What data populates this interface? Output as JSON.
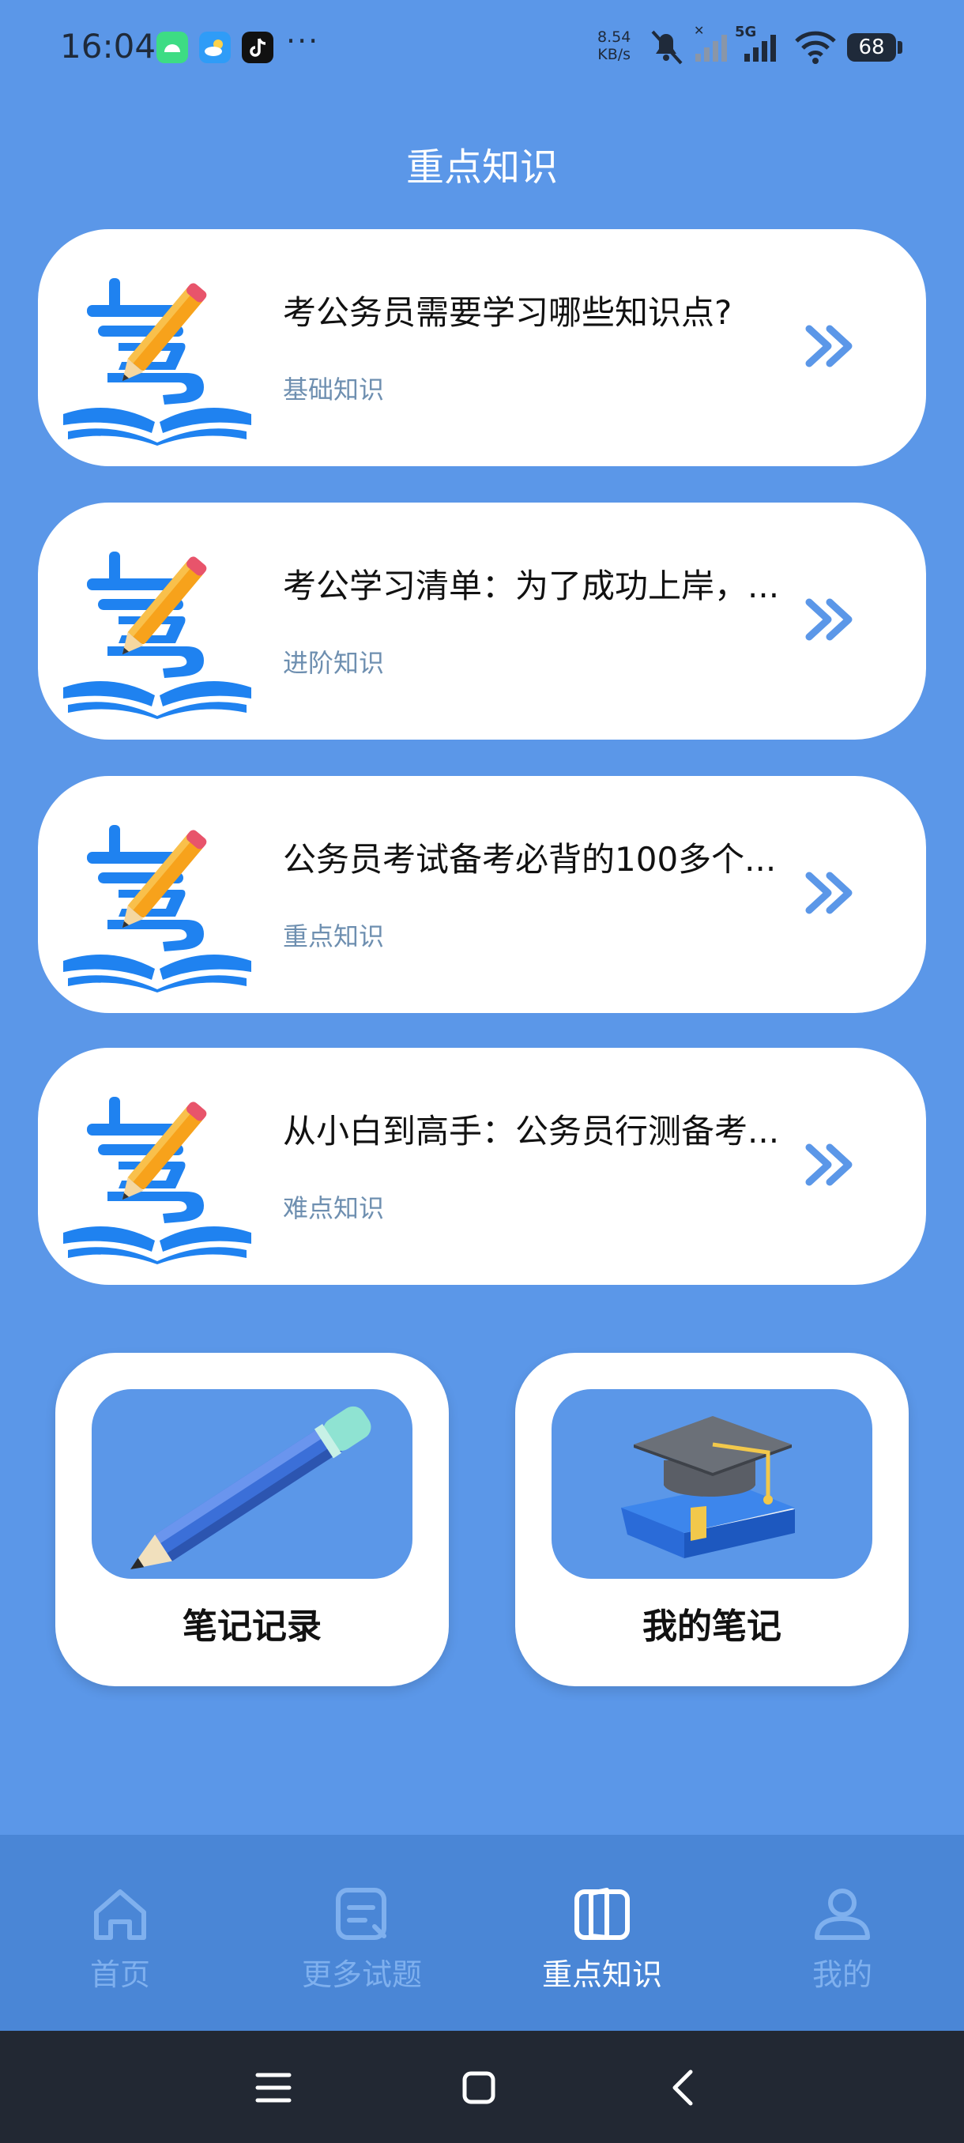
{
  "status_bar": {
    "time": "16:04",
    "net_speed_value": "8.54",
    "net_speed_unit": "KB/s",
    "network_type": "5G",
    "battery": "68",
    "more": "···",
    "icons": [
      "android-app-icon",
      "weather-app-icon",
      "tiktok-app-icon",
      "mute-icon",
      "signal-icon",
      "signal-5g-icon",
      "wifi-icon",
      "battery-icon"
    ]
  },
  "page": {
    "title": "重点知识"
  },
  "cards": [
    {
      "title": "考公务员需要学习哪些知识点?",
      "subtitle": "基础知识"
    },
    {
      "title": "考公学习清单：为了成功上岸，...",
      "subtitle": "进阶知识"
    },
    {
      "title": "公务员考试备考必背的100多个...",
      "subtitle": "重点知识"
    },
    {
      "title": "从小白到高手：公务员行测备考...",
      "subtitle": "难点知识"
    }
  ],
  "tiles": [
    {
      "label": "笔记记录",
      "icon": "pencil-icon"
    },
    {
      "label": "我的笔记",
      "icon": "graduation-cap-book-icon"
    }
  ],
  "nav": [
    {
      "label": "首页",
      "icon": "home-icon",
      "active": false
    },
    {
      "label": "更多试题",
      "icon": "exam-icon",
      "active": false
    },
    {
      "label": "重点知识",
      "icon": "book-icon",
      "active": true
    },
    {
      "label": "我的",
      "icon": "user-icon",
      "active": false
    }
  ],
  "colors": {
    "background": "#5b97e8",
    "nav_background": "#4a86d6",
    "card_background": "#ffffff",
    "accent": "#1f82f0",
    "subtitle": "#6e8fb0",
    "nav_inactive": "#7fb0ee",
    "nav_active": "#ffffff"
  }
}
